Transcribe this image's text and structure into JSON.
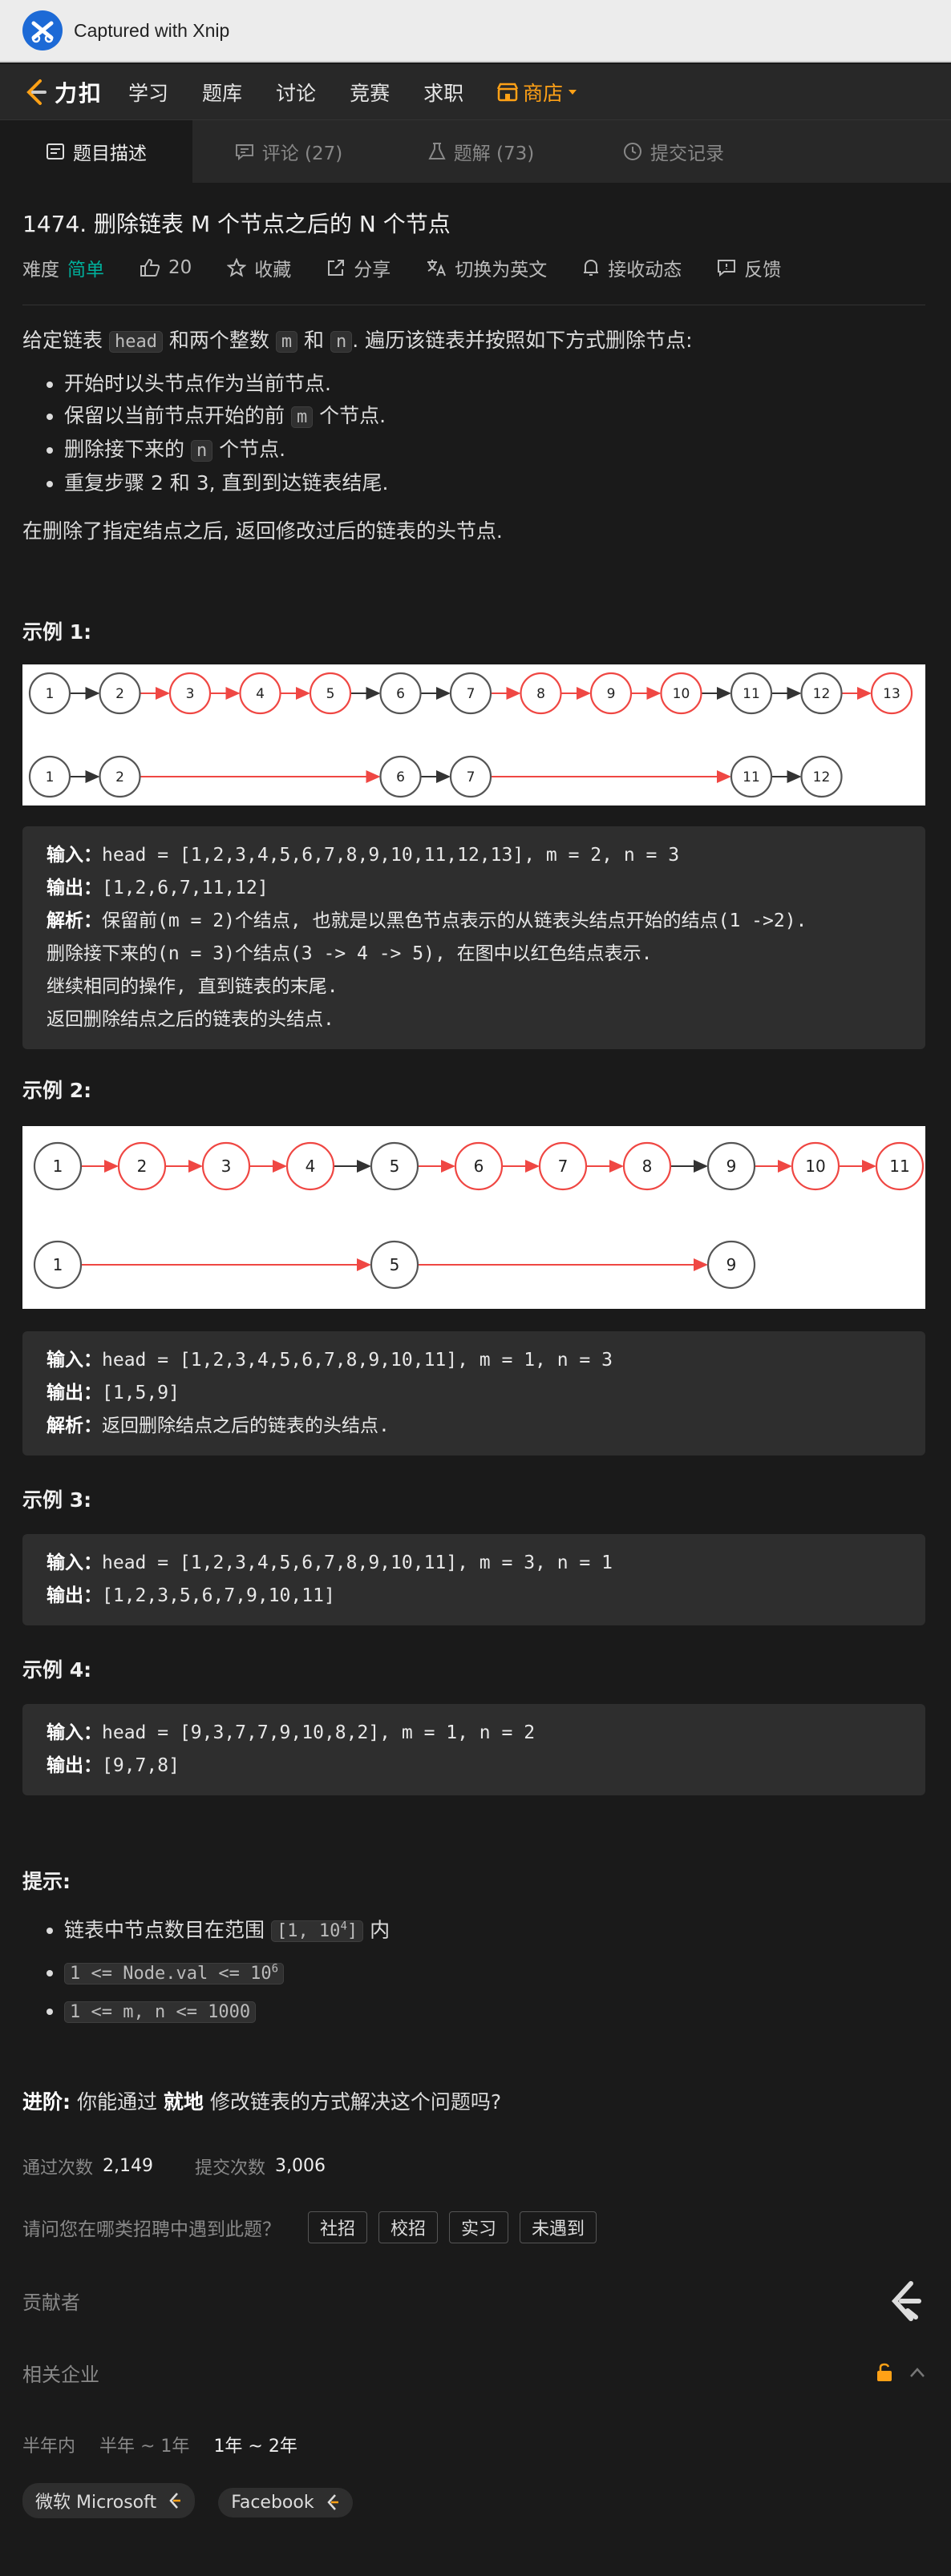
{
  "xnip": {
    "title": "Captured with Xnip"
  },
  "nav": {
    "brand": "力扣",
    "items": [
      "学习",
      "题库",
      "讨论",
      "竞赛",
      "求职"
    ],
    "store": "商店"
  },
  "tabs": [
    "题目描述",
    "评论 (27)",
    "题解 (73)",
    "提交记录"
  ],
  "problem": {
    "title": "1474. 删除链表 M 个节点之后的 N 个节点",
    "difficulty_label": "难度",
    "difficulty": "简单",
    "likes": "20",
    "collect": "收藏",
    "share": "分享",
    "switch_en": "切换为英文",
    "notify": "接收动态",
    "feedback": "反馈"
  },
  "description": {
    "intro_a": "给定链表 ",
    "head": "head",
    "intro_b": " 和两个整数 ",
    "m": "m",
    "and": " 和 ",
    "n": "n",
    "intro_c": ". 遍历该链表并按照如下方式删除节点:",
    "b1": "开始时以头节点作为当前节点.",
    "b2a": "保留以当前节点开始的前 ",
    "b2b": " 个节点.",
    "b3a": "删除接下来的 ",
    "b3b": " 个节点.",
    "b4": "重复步骤 2 和 3, 直到到达链表结尾.",
    "outro": "在删除了指定结点之后, 返回修改过后的链表的头节点."
  },
  "examples": [
    {
      "title": "示例 1:",
      "input_label": "输入：",
      "input": "head = [1,2,3,4,5,6,7,8,9,10,11,12,13], m = 2, n = 3",
      "output_label": "输出：",
      "output": "[1,2,6,7,11,12]",
      "explain_label": "解析：",
      "explain": "保留前(m = 2)个结点,  也就是以黑色节点表示的从链表头结点开始的结点(1 ->2).",
      "explain2": "删除接下来的(n = 3)个结点(3 -> 4 -> 5), 在图中以红色结点表示.",
      "explain3": "继续相同的操作, 直到链表的末尾.",
      "explain4": "返回删除结点之后的链表的头结点."
    },
    {
      "title": "示例 2:",
      "input_label": "输入：",
      "input": "head = [1,2,3,4,5,6,7,8,9,10,11], m = 1, n = 3",
      "output_label": "输出：",
      "output": "[1,5,9]",
      "explain_label": "解析：",
      "explain": "返回删除结点之后的链表的头结点."
    },
    {
      "title": "示例 3:",
      "input_label": "输入：",
      "input": "head = [1,2,3,4,5,6,7,8,9,10,11], m = 3, n = 1",
      "output_label": "输出：",
      "output": "[1,2,3,5,6,7,9,10,11]"
    },
    {
      "title": "示例 4:",
      "input_label": "输入：",
      "input": "head = [9,3,7,7,9,10,8,2], m = 1, n = 2",
      "output_label": "输出：",
      "output": "[9,7,8]"
    }
  ],
  "diagram1": {
    "top": [
      "1",
      "2",
      "3",
      "4",
      "5",
      "6",
      "7",
      "8",
      "9",
      "10",
      "11",
      "12",
      "13"
    ],
    "bottom": [
      "1",
      "2",
      "6",
      "7",
      "11",
      "12"
    ]
  },
  "diagram2": {
    "top": [
      "1",
      "2",
      "3",
      "4",
      "5",
      "6",
      "7",
      "8",
      "9",
      "10",
      "11"
    ],
    "bottom": [
      "1",
      "5",
      "9"
    ]
  },
  "hints": {
    "title": "提示:",
    "h1a": "链表中节点数目在范围 ",
    "h1code": "[1, 10",
    "h1sup": "4",
    "h1close": "]",
    "h1b": " 内",
    "h2code": "1 <= Node.val <= 10",
    "h2sup": "6",
    "h3code": "1 <= m, n <= 1000"
  },
  "advanced": {
    "label": "进阶:",
    "a": " 你能通过 ",
    "bold": "就地",
    "b": " 修改链表的方式解决这个问题吗?"
  },
  "stats": {
    "accepted_label": "通过次数",
    "accepted": "2,149",
    "submitted_label": "提交次数",
    "submitted": "3,006"
  },
  "recruit": {
    "question": "请问您在哪类招聘中遇到此题？",
    "options": [
      "社招",
      "校招",
      "实习",
      "未遇到"
    ]
  },
  "contributors": {
    "title": "贡献者"
  },
  "companies": {
    "title": "相关企业",
    "ranges": [
      "半年内",
      "半年 ~ 1年",
      "1年 ~ 2年"
    ],
    "list": [
      "微软 Microsoft",
      "Facebook"
    ]
  },
  "colors": {
    "accent": "#ffa116",
    "easy": "#00af9b",
    "red_node": "#ef4743",
    "black_node": "#555555"
  }
}
